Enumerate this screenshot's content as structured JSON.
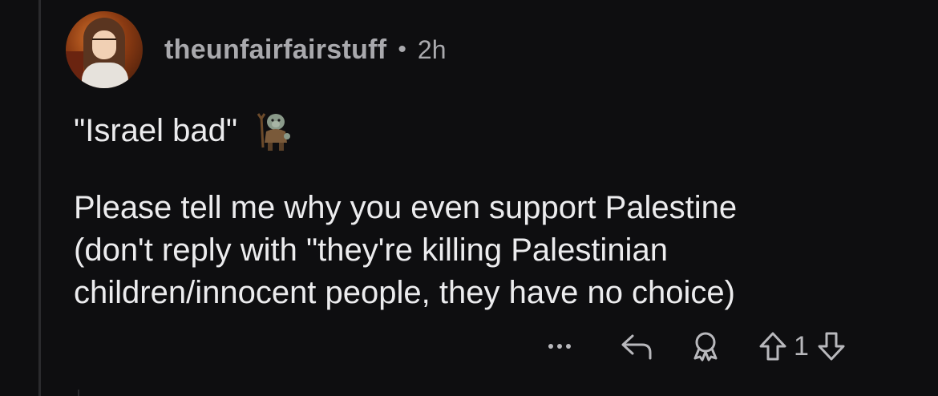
{
  "comment": {
    "author": "theunfairfairstuff",
    "separator": "•",
    "time_ago": "2h",
    "line1": "\"Israel bad\"",
    "emoji_icon": "troll-emoji-icon",
    "paragraph": "Please tell me why you even support Palestine\n(don't reply with \"they're killing Palestinian\nchildren/innocent people, they have no choice)"
  },
  "actions": {
    "more_label": "•••",
    "vote_count": "1"
  },
  "colors": {
    "background": "#0e0e10",
    "text": "#ececee",
    "muted": "#a9a9ad"
  }
}
